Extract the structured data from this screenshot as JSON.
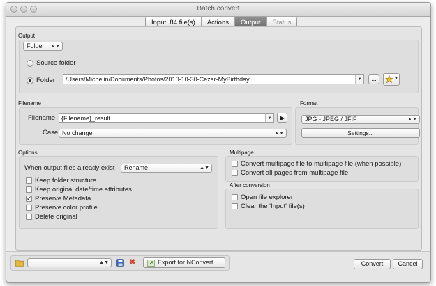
{
  "window": {
    "title": "Batch convert"
  },
  "tabs": [
    {
      "label": "Input: 84 file(s)",
      "active": false,
      "disabled": false
    },
    {
      "label": "Actions",
      "active": false,
      "disabled": false
    },
    {
      "label": "Output",
      "active": true,
      "disabled": false
    },
    {
      "label": "Status",
      "active": false,
      "disabled": true
    }
  ],
  "output": {
    "group_label": "Output",
    "mode_select": "Folder",
    "source_folder_label": "Source folder",
    "folder_label": "Folder",
    "selected": "folder",
    "folder_path": "/Users/Michelin/Documents/Photos/2010-10-30-Cezar-MyBirthday",
    "browse_label": "...",
    "favorites_icon": "star-icon"
  },
  "filename": {
    "group_label": "Filename",
    "filename_label": "Filename",
    "filename_value": "{Filename}_result",
    "case_label": "Case",
    "case_value": "No change"
  },
  "format": {
    "group_label": "Format",
    "format_value": "JPG - JPEG / JFIF",
    "settings_label": "Settings..."
  },
  "options": {
    "group_label": "Options",
    "exist_label": "When output files already exist",
    "exist_value": "Rename",
    "checkboxes": [
      {
        "label": "Keep folder structure",
        "checked": false
      },
      {
        "label": "Keep original date/time attributes",
        "checked": false
      },
      {
        "label": "Preserve Metadata",
        "checked": true
      },
      {
        "label": "Preserve color profile",
        "checked": false
      },
      {
        "label": "Delete original",
        "checked": false
      }
    ]
  },
  "multipage": {
    "group_label": "Multipage",
    "checkboxes": [
      {
        "label": "Convert multipage file to multipage file (when possible)",
        "checked": false
      },
      {
        "label": "Convert all pages from multipage file",
        "checked": false
      }
    ]
  },
  "after": {
    "group_label": "After conversion",
    "checkboxes": [
      {
        "label": "Open file explorer",
        "checked": false
      },
      {
        "label": "Clear the 'Input' file(s)",
        "checked": false
      }
    ]
  },
  "bottom": {
    "preset_value": "",
    "export_label": "Export for NConvert...",
    "convert_label": "Convert",
    "cancel_label": "Cancel"
  },
  "colors": {
    "active_tab": "#7d7d7d",
    "star": "#f0c020",
    "delete": "#d24a3a",
    "folder": "#e3b93c",
    "save": "#3a64b8"
  }
}
